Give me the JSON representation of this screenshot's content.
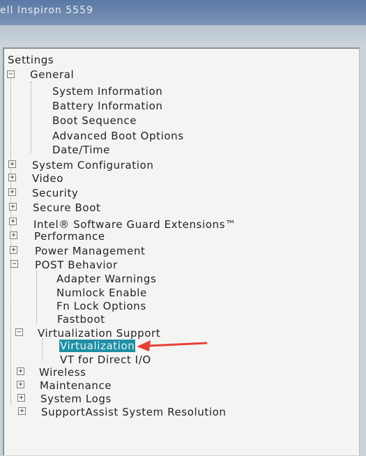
{
  "window": {
    "title": "ell Inspiron 5559"
  },
  "tree": {
    "root": "Settings",
    "general": {
      "label": "General",
      "children": [
        "System Information",
        "Battery Information",
        "Boot Sequence",
        "Advanced Boot Options",
        "Date/Time"
      ]
    },
    "system_configuration": "System Configuration",
    "video": "Video",
    "security": "Security",
    "secure_boot": "Secure Boot",
    "intel_sgx": "Intel® Software Guard Extensions™",
    "performance": "Performance",
    "power_management": "Power Management",
    "post_behavior": {
      "label": "POST Behavior",
      "children": [
        "Adapter Warnings",
        "Numlock Enable",
        "Fn Lock Options",
        "Fastboot"
      ]
    },
    "virtualization_support": {
      "label": "Virtualization Support",
      "children": [
        "Virtualization",
        "VT for Direct I/O"
      ]
    },
    "wireless": "Wireless",
    "maintenance": "Maintenance",
    "system_logs": "System Logs",
    "supportassist": "SupportAssist System Resolution"
  },
  "expander_symbols": {
    "expanded": "−",
    "collapsed": "+"
  },
  "colors": {
    "selection": "#1f8fa5",
    "annotation_arrow": "#e8413a",
    "titlebar": "#5a79a6"
  }
}
